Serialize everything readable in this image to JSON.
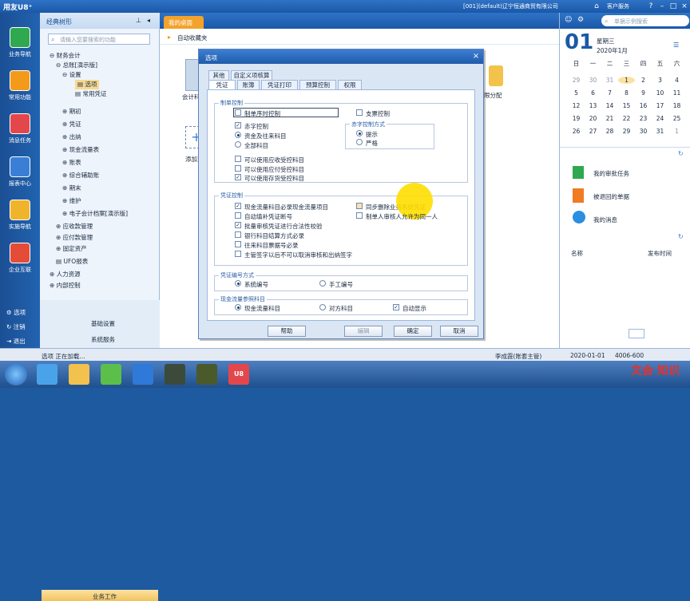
{
  "titlebar": {
    "app": "用友U8⁺",
    "company": "[001](default)辽宁恒通商贸有限公司",
    "service": "客户服务"
  },
  "leftnav": [
    {
      "label": "业务导航",
      "color": "#2fa84f"
    },
    {
      "label": "常用功能",
      "color": "#f39a1b"
    },
    {
      "label": "消息任务",
      "color": "#e4474b"
    },
    {
      "label": "报表中心",
      "color": "#3a7fd5"
    },
    {
      "label": "实施导航",
      "color": "#f0b42c"
    },
    {
      "label": "企业互联",
      "color": "#e44c37"
    }
  ],
  "leftnav_bottom": [
    "选项",
    "注销",
    "退出"
  ],
  "tree": {
    "title": "经典树形",
    "search_placeholder": "请输入您要搜索的功能",
    "items": [
      "财务会计",
      "总账[演示版]",
      "设置",
      "选项",
      "常用凭证",
      "期初",
      "凭证",
      "出纳",
      "现金流量表",
      "账表",
      "综合辅助账",
      "期末",
      "维护",
      "电子会计档案[演示版]",
      "应收款管理",
      "应付款管理",
      "固定资产",
      "UFO报表",
      "人力资源",
      "内部控制"
    ],
    "bottom": [
      "业务工作",
      "基础设置",
      "系统服务"
    ]
  },
  "main": {
    "tab": "我的桌面",
    "fav": "自动收藏夹",
    "tiles": [
      "会计科目",
      "添加更",
      "限分配"
    ]
  },
  "right": {
    "search_placeholder": "单据示例搜索",
    "day": "01",
    "weekday": "星期三",
    "month": "2020年1月",
    "week_header": [
      "日",
      "一",
      "二",
      "三",
      "四",
      "五",
      "六"
    ],
    "weeks": [
      [
        "29",
        "30",
        "31",
        "1",
        "2",
        "3",
        "4"
      ],
      [
        "5",
        "6",
        "7",
        "8",
        "9",
        "10",
        "11"
      ],
      [
        "12",
        "13",
        "14",
        "15",
        "16",
        "17",
        "18"
      ],
      [
        "19",
        "20",
        "21",
        "22",
        "23",
        "24",
        "25"
      ],
      [
        "26",
        "27",
        "28",
        "29",
        "30",
        "31",
        "1"
      ]
    ],
    "tasks": [
      "我的审批任务",
      "被退回的单据",
      "我的消息"
    ],
    "table_headers": [
      "名称",
      "发布时间"
    ]
  },
  "dialog": {
    "title": "选项",
    "tabs_row1": [
      "其他",
      "自定义项核算"
    ],
    "tabs_row2": [
      "凭证",
      "账簿",
      "凭证打印",
      "预算控制",
      "权限"
    ],
    "group_zhidan": "制单控制",
    "opt_xuhao": "制单序时控制",
    "opt_zhipiao": "支票控制",
    "opt_chizi": "赤字控制",
    "opt_zijin": "资金及往来科目",
    "opt_quanbu": "全部科目",
    "chizi_mode": "赤字控制方式",
    "mode_tishi": "提示",
    "mode_yange": "严格",
    "opt_ys": "可以使用应收受控科目",
    "opt_yf": "可以使用应付受控科目",
    "opt_ch": "可以使用存货受控科目",
    "group_pingzheng": "凭证控制",
    "opt_xj": "现金流量科目必录现金流量项目",
    "opt_tongbu": "同步删除业务系统凭证",
    "opt_duanhao": "自动填补凭证断号",
    "opt_shenhe": "制单人审核人允许为同一人",
    "opt_pili": "批量审核凭证进行合法性校验",
    "opt_yinhang": "银行科目结算方式必录",
    "opt_wanglai": "往来科目票据号必录",
    "opt_zhuguan": "主管签字以后不可以取消审核和出纳签字",
    "group_bianhao": "凭证编号方式",
    "opt_xitong": "系统编号",
    "opt_shougong": "手工编号",
    "group_xjll": "现金流量参照科目",
    "opt_xjkm": "现金流量科目",
    "opt_duifang": "对方科目",
    "opt_auto": "自动显示",
    "btn_help": "帮助",
    "btn_edit": "编辑",
    "btn_ok": "确定",
    "btn_cancel": "取消"
  },
  "status": {
    "left": "选项 正在加载...",
    "user": "李成霞(账套主管)",
    "date": "2020-01-01",
    "phone": "4006-600",
    "logo": "文会 知识"
  }
}
